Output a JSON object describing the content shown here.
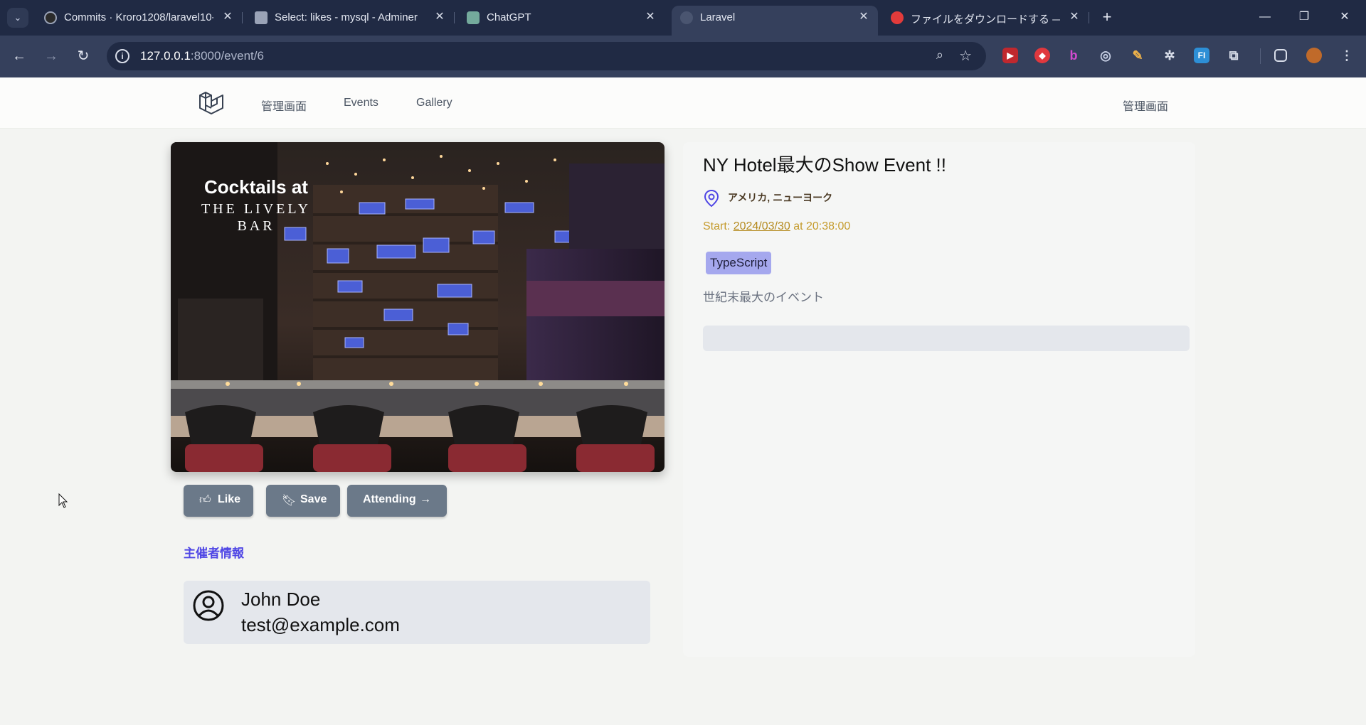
{
  "browser": {
    "tabs": [
      {
        "title": "Commits · Kroro1208/laravel10-",
        "icon": "github-icon"
      },
      {
        "title": "Select: likes - mysql - Adminer",
        "icon": "adminer-icon"
      },
      {
        "title": "ChatGPT",
        "icon": "chatgpt-icon"
      },
      {
        "title": "Laravel",
        "icon": "globe-icon",
        "active": true
      },
      {
        "title": "ファイルをダウンロードする — Conve",
        "icon": "convertio-icon"
      }
    ],
    "url_host": "127.0.0.1",
    "url_path": ":8000/event/6"
  },
  "nav": {
    "links": [
      "管理画面",
      "Events",
      "Gallery"
    ],
    "right_link": "管理画面"
  },
  "event": {
    "image_caption_line1": "Cocktails at",
    "image_caption_line2": "THE LIVELY",
    "image_caption_line3": "BAR",
    "title": "NY Hotel最大のShow Event !!",
    "location": "アメリカ, ニューヨーク",
    "start_prefix": "Start: ",
    "start_date": "2024/03/30",
    "start_time": " at 20:38:00",
    "tag": "TypeScript",
    "description": "世紀末最大のイベント"
  },
  "actions": {
    "like_label": "Like",
    "save_label": "Save",
    "attending_label": "Attending"
  },
  "organizer": {
    "heading": "主催者情報",
    "name": "John Doe",
    "email": "test@example.com"
  },
  "colors": {
    "accent": "#4f46e5",
    "tag_bg": "#a5a8ee",
    "button_bg": "#6b7989",
    "start_text": "#c59b2c"
  }
}
